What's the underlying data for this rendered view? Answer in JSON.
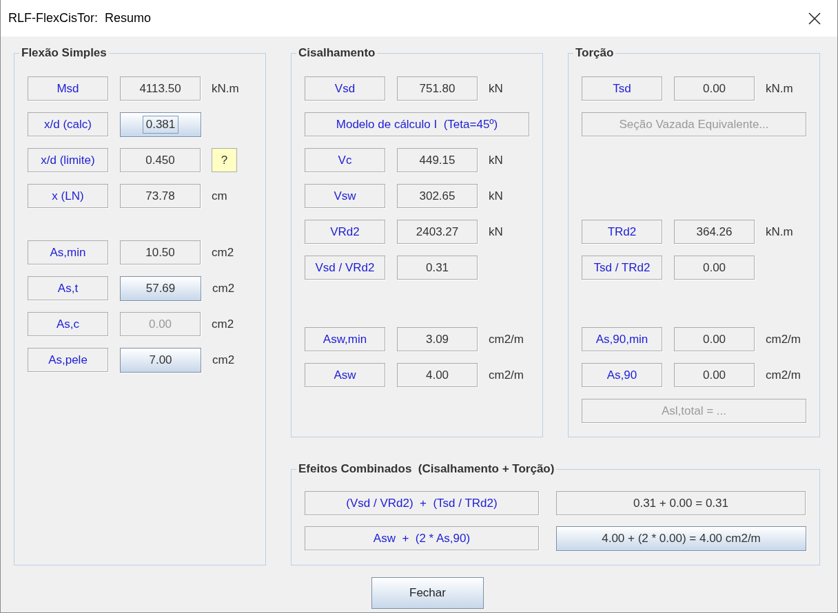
{
  "window": {
    "title": "RLF-FlexCisTor:  Resumo"
  },
  "panels": [
    {
      "title": "Flexão Simples",
      "rows": [
        {
          "kind": "pair",
          "label": "Msd",
          "value": {
            "text": "4113.50",
            "kind": "plain"
          },
          "unit": "kN.m"
        },
        {
          "kind": "pair",
          "label": "x/d (calc)",
          "value": {
            "text": "0.381",
            "kind": "focused"
          }
        },
        {
          "kind": "pair",
          "label": "x/d (limite)",
          "value": {
            "text": "0.450",
            "kind": "plain"
          },
          "help": "?"
        },
        {
          "kind": "pair",
          "label": "x (LN)",
          "value": {
            "text": "73.78",
            "kind": "plain"
          },
          "unit": "cm"
        },
        {
          "kind": "spacer"
        },
        {
          "kind": "pair",
          "label": "As,min",
          "value": {
            "text": "10.50",
            "kind": "plain"
          },
          "unit": "cm2"
        },
        {
          "kind": "pair",
          "label": "As,t",
          "value": {
            "text": "57.69",
            "kind": "raised"
          },
          "unit": "cm2"
        },
        {
          "kind": "pair",
          "label": "As,c",
          "value": {
            "text": "0.00",
            "kind": "disabled"
          },
          "unit": "cm2"
        },
        {
          "kind": "pair",
          "label": "As,pele",
          "value": {
            "text": "7.00",
            "kind": "raised"
          },
          "unit": "cm2"
        }
      ]
    },
    {
      "title": "Cisalhamento",
      "rows": [
        {
          "kind": "pair",
          "label": "Vsd",
          "value": {
            "text": "751.80",
            "kind": "plain"
          },
          "unit": "kN"
        },
        {
          "kind": "wide",
          "text": "Modelo de cálculo I  (Teta=45º)",
          "disabled": false
        },
        {
          "kind": "pair",
          "label": "Vc",
          "value": {
            "text": "449.15",
            "kind": "plain"
          },
          "unit": "kN"
        },
        {
          "kind": "pair",
          "label": "Vsw",
          "value": {
            "text": "302.65",
            "kind": "plain"
          },
          "unit": "kN"
        },
        {
          "kind": "pair",
          "label": "VRd2",
          "value": {
            "text": "2403.27",
            "kind": "plain"
          },
          "unit": "kN"
        },
        {
          "kind": "pair",
          "label": "Vsd / VRd2",
          "value": {
            "text": "0.31",
            "kind": "plain"
          }
        },
        {
          "kind": "spacer"
        },
        {
          "kind": "pair",
          "label": "Asw,min",
          "value": {
            "text": "3.09",
            "kind": "plain"
          },
          "unit": "cm2/m"
        },
        {
          "kind": "pair",
          "label": "Asw",
          "value": {
            "text": "4.00",
            "kind": "plain"
          },
          "unit": "cm2/m"
        }
      ]
    },
    {
      "title": "Torção",
      "rows": [
        {
          "kind": "pair",
          "label": "Tsd",
          "value": {
            "text": "0.00",
            "kind": "plain"
          },
          "unit": "kN.m"
        },
        {
          "kind": "wide",
          "text": "Seção Vazada Equivalente...",
          "disabled": true
        },
        {
          "kind": "spacer"
        },
        {
          "kind": "spacer"
        },
        {
          "kind": "pair",
          "label": "TRd2",
          "value": {
            "text": "364.26",
            "kind": "plain"
          },
          "unit": "kN.m"
        },
        {
          "kind": "pair",
          "label": "Tsd / TRd2",
          "value": {
            "text": "0.00",
            "kind": "plain"
          }
        },
        {
          "kind": "spacer"
        },
        {
          "kind": "pair",
          "label": "As,90,min",
          "value": {
            "text": "0.00",
            "kind": "plain"
          },
          "unit": "cm2/m"
        },
        {
          "kind": "pair",
          "label": "As,90",
          "value": {
            "text": "0.00",
            "kind": "plain"
          },
          "unit": "cm2/m"
        },
        {
          "kind": "wide",
          "text": "Asl,total = ...",
          "disabled": true
        }
      ]
    }
  ],
  "combined": {
    "title": "Efeitos Combinados  (Cisalhamento + Torção)",
    "rows": [
      {
        "label": "(Vsd / VRd2)  +  (Tsd / TRd2)",
        "value": {
          "text": "0.31 + 0.00 = 0.31",
          "kind": "plain"
        }
      },
      {
        "label": "Asw  +  (2 * As,90)",
        "value": {
          "text": "4.00 + (2 * 0.00) = 4.00 cm2/m",
          "kind": "raised"
        }
      }
    ]
  },
  "buttons": [
    {
      "label": "Fechar"
    }
  ]
}
